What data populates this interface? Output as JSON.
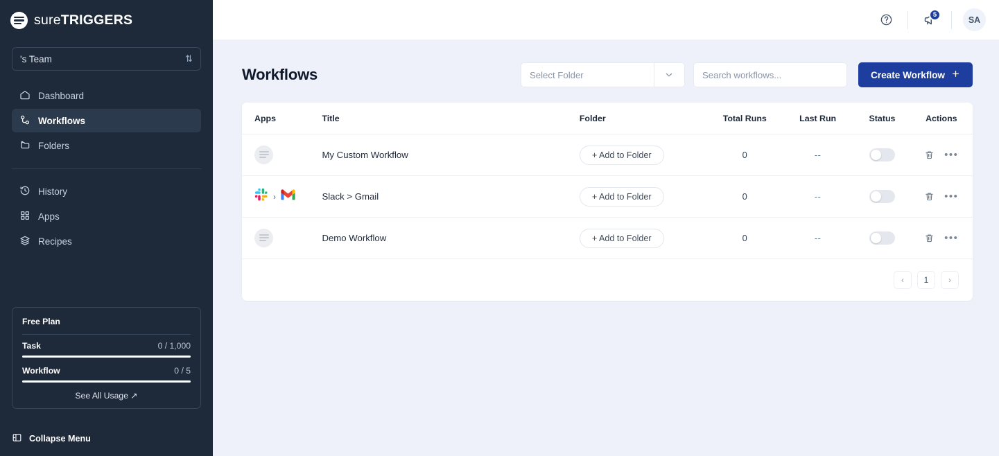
{
  "sidebar": {
    "brand": {
      "light": "sure",
      "bold": "TRIGGERS",
      "logo_icon": "suretriggers-logo-icon"
    },
    "team": {
      "label": "'s Team",
      "sort_icon": "sort-updown-icon"
    },
    "nav_primary": [
      {
        "label": "Dashboard",
        "icon": "home-icon",
        "active": false
      },
      {
        "label": "Workflows",
        "icon": "workflow-nodes-icon",
        "active": true
      },
      {
        "label": "Folders",
        "icon": "folder-icon",
        "active": false
      }
    ],
    "nav_secondary": [
      {
        "label": "History",
        "icon": "clock-history-icon",
        "active": false
      },
      {
        "label": "Apps",
        "icon": "grid-apps-icon",
        "active": false
      },
      {
        "label": "Recipes",
        "icon": "layers-recipes-icon",
        "active": false
      }
    ],
    "plan": {
      "title": "Free Plan",
      "meters": [
        {
          "name": "Task",
          "value": "0 / 1,000",
          "percent": 0
        },
        {
          "name": "Workflow",
          "value": "0 / 5",
          "percent": 0
        }
      ],
      "see_all_usage": "See All Usage ↗"
    },
    "collapse": {
      "label": "Collapse Menu",
      "icon": "collapse-panel-icon"
    }
  },
  "topbar": {
    "help_icon": "help-circle-icon",
    "announcements_icon": "megaphone-icon",
    "announcements_badge": "5",
    "avatar_initials": "SA"
  },
  "toolbar": {
    "page_title": "Workflows",
    "folder_select_placeholder": "Select Folder",
    "folder_select_caret_icon": "chevron-down-icon",
    "search_placeholder": "Search workflows...",
    "create_label": "Create Workflow",
    "create_plus_icon": "plus-icon"
  },
  "table": {
    "columns": [
      "Apps",
      "Title",
      "Folder",
      "Total Runs",
      "Last Run",
      "Status",
      "Actions"
    ],
    "rows": [
      {
        "apps": [
          "suretriggers-generic-icon"
        ],
        "title": "My Custom Workflow",
        "folder_button": "+ Add to Folder",
        "total_runs": "0",
        "last_run": "--",
        "status_on": false,
        "delete_icon": "trash-icon",
        "more_icon": "ellipsis-icon"
      },
      {
        "apps": [
          "slack-icon",
          "gmail-icon"
        ],
        "title": "Slack > Gmail",
        "folder_button": "+ Add to Folder",
        "total_runs": "0",
        "last_run": "--",
        "status_on": false,
        "delete_icon": "trash-icon",
        "more_icon": "ellipsis-icon"
      },
      {
        "apps": [
          "suretriggers-generic-icon"
        ],
        "title": "Demo Workflow",
        "folder_button": "+ Add to Folder",
        "total_runs": "0",
        "last_run": "--",
        "status_on": false,
        "delete_icon": "trash-icon",
        "more_icon": "ellipsis-icon"
      }
    ],
    "pagination": {
      "prev": "‹",
      "pages": [
        "1"
      ],
      "next": "›"
    }
  },
  "colors": {
    "sidebar_bg": "#1e2a3a",
    "accent_blue": "#1d3e9e",
    "page_bg": "#eef1f9",
    "card_bg": "#ffffff"
  }
}
